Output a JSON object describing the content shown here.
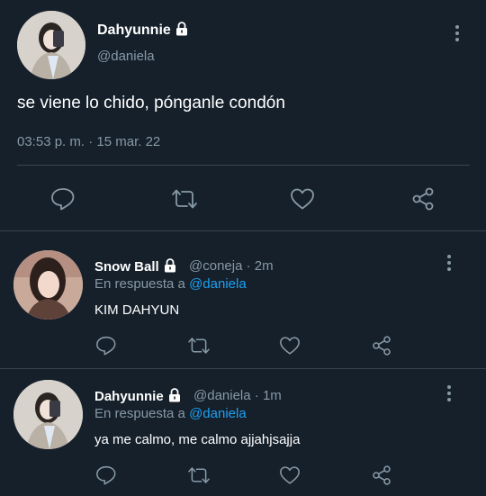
{
  "main_tweet": {
    "display_name": "Dahyunnie",
    "handle": "@daniela",
    "text": "se viene lo chido, pónganle condón",
    "timestamp": "03:53 p. m. · 15 mar. 22"
  },
  "replies": [
    {
      "display_name": "Snow Ball",
      "handle": "@coneja",
      "time": "· 2m",
      "reply_prefix": "En respuesta a",
      "reply_to": "@daniela",
      "text": "KIM DAHYUN"
    },
    {
      "display_name": "Dahyunnie",
      "handle": "@daniela",
      "time": "· 1m",
      "reply_prefix": "En respuesta a",
      "reply_to": "@daniela",
      "text": "ya me calmo, me calmo ajjahjsajja"
    }
  ],
  "icons": [
    "reply-icon",
    "retweet-icon",
    "like-icon",
    "share-icon",
    "lock-icon",
    "more-icon"
  ],
  "colors": {
    "background": "#15202b",
    "text": "#ffffff",
    "muted": "#8899a6",
    "link": "#1da1f2",
    "divider": "#38444d"
  }
}
